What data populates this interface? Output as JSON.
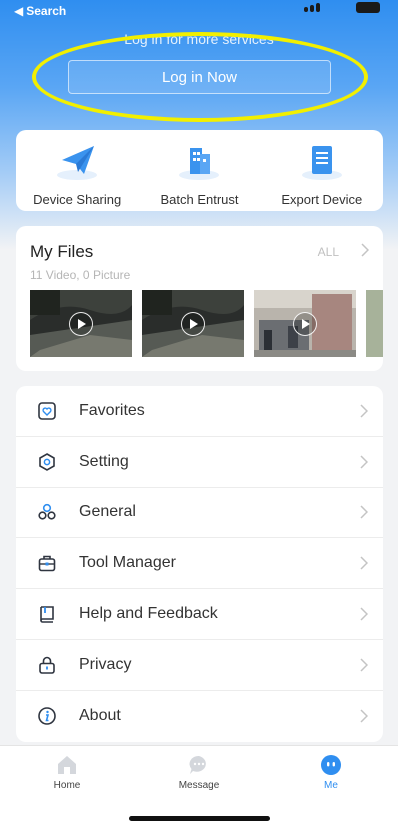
{
  "status": {
    "back_label": "Search"
  },
  "login": {
    "subtitle": "Log in for more services",
    "button_label": "Log in Now"
  },
  "quick_actions": [
    {
      "label": "Device Sharing",
      "icon": "paper-plane-icon"
    },
    {
      "label": "Batch Entrust",
      "icon": "building-icon"
    },
    {
      "label": "Export Device",
      "icon": "document-icon"
    }
  ],
  "files": {
    "title": "My Files",
    "all_label": "ALL",
    "count": "11 Video,  0 Picture"
  },
  "menu": [
    {
      "label": "Favorites",
      "icon": "heart-icon"
    },
    {
      "label": "Setting",
      "icon": "hexagon-gear-icon"
    },
    {
      "label": "General",
      "icon": "circles-icon"
    },
    {
      "label": "Tool Manager",
      "icon": "toolbox-icon"
    },
    {
      "label": "Help and Feedback",
      "icon": "book-icon"
    },
    {
      "label": "Privacy",
      "icon": "lock-icon"
    },
    {
      "label": "About",
      "icon": "info-icon"
    }
  ],
  "tabs": [
    {
      "label": "Home",
      "active": false
    },
    {
      "label": "Message",
      "active": false
    },
    {
      "label": "Me",
      "active": true
    }
  ],
  "colors": {
    "accent": "#2f8ef0",
    "highlight": "#f2ef00"
  }
}
